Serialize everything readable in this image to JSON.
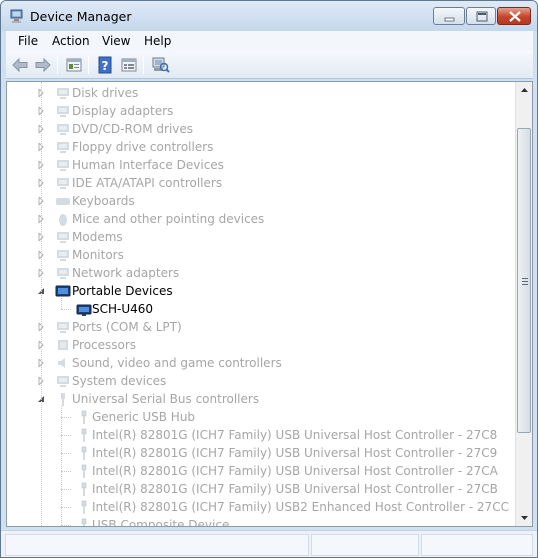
{
  "window": {
    "title": "Device Manager"
  },
  "menu": [
    {
      "label": "File"
    },
    {
      "label": "Action"
    },
    {
      "label": "View"
    },
    {
      "label": "Help"
    }
  ],
  "toolbar": [
    {
      "name": "back-button",
      "icon": "back-arrow-icon"
    },
    {
      "name": "forward-button",
      "icon": "forward-arrow-icon"
    },
    {
      "name": "show-hide-console-tree-button",
      "icon": "console-tree-icon"
    },
    {
      "name": "help-button",
      "icon": "help-icon"
    },
    {
      "name": "properties-button",
      "icon": "properties-icon"
    },
    {
      "name": "scan-hardware-changes-button",
      "icon": "scan-hardware-icon"
    }
  ],
  "tree": [
    {
      "label": "Disk drives",
      "state": "dim",
      "expander": "collapsed",
      "icon": "disk-drive-icon"
    },
    {
      "label": "Display adapters",
      "state": "dim",
      "expander": "collapsed",
      "icon": "display-adapter-icon"
    },
    {
      "label": "DVD/CD-ROM drives",
      "state": "dim",
      "expander": "collapsed",
      "icon": "dvd-drive-icon"
    },
    {
      "label": "Floppy drive controllers",
      "state": "dim",
      "expander": "collapsed",
      "icon": "floppy-controller-icon"
    },
    {
      "label": "Human Interface Devices",
      "state": "dim",
      "expander": "collapsed",
      "icon": "hid-icon"
    },
    {
      "label": "IDE ATA/ATAPI controllers",
      "state": "dim",
      "expander": "collapsed",
      "icon": "ide-controller-icon"
    },
    {
      "label": "Keyboards",
      "state": "dim",
      "expander": "collapsed",
      "icon": "keyboard-icon"
    },
    {
      "label": "Mice and other pointing devices",
      "state": "dim",
      "expander": "collapsed",
      "icon": "mouse-icon"
    },
    {
      "label": "Modems",
      "state": "dim",
      "expander": "collapsed",
      "icon": "modem-icon"
    },
    {
      "label": "Monitors",
      "state": "dim",
      "expander": "collapsed",
      "icon": "monitor-icon"
    },
    {
      "label": "Network adapters",
      "state": "dim",
      "expander": "collapsed",
      "icon": "network-adapter-icon"
    },
    {
      "label": "Portable Devices",
      "state": "active",
      "expander": "expanded",
      "icon": "portable-device-icon"
    },
    {
      "label": "SCH-U460",
      "state": "active",
      "expander": "none",
      "icon": "phone-device-icon",
      "child": true
    },
    {
      "label": "Ports (COM & LPT)",
      "state": "dim",
      "expander": "collapsed",
      "icon": "port-icon"
    },
    {
      "label": "Processors",
      "state": "dim",
      "expander": "collapsed",
      "icon": "processor-icon"
    },
    {
      "label": "Sound, video and game controllers",
      "state": "dim",
      "expander": "collapsed",
      "icon": "sound-icon"
    },
    {
      "label": "System devices",
      "state": "dim",
      "expander": "collapsed",
      "icon": "system-device-icon"
    },
    {
      "label": "Universal Serial Bus controllers",
      "state": "dim",
      "expander": "expanded",
      "icon": "usb-icon"
    },
    {
      "label": "Generic USB Hub",
      "state": "dim",
      "expander": "none",
      "icon": "usb-plug-icon",
      "child": true
    },
    {
      "label": "Intel(R) 82801G (ICH7 Family) USB Universal Host Controller - 27C8",
      "state": "dim",
      "expander": "none",
      "icon": "usb-plug-icon",
      "child": true
    },
    {
      "label": "Intel(R) 82801G (ICH7 Family) USB Universal Host Controller - 27C9",
      "state": "dim",
      "expander": "none",
      "icon": "usb-plug-icon",
      "child": true
    },
    {
      "label": "Intel(R) 82801G (ICH7 Family) USB Universal Host Controller - 27CA",
      "state": "dim",
      "expander": "none",
      "icon": "usb-plug-icon",
      "child": true
    },
    {
      "label": "Intel(R) 82801G (ICH7 Family) USB Universal Host Controller - 27CB",
      "state": "dim",
      "expander": "none",
      "icon": "usb-plug-icon",
      "child": true
    },
    {
      "label": "Intel(R) 82801G (ICH7 Family) USB2 Enhanced Host Controller - 27CC",
      "state": "dim",
      "expander": "none",
      "icon": "usb-plug-icon",
      "child": true
    },
    {
      "label": "USB Composite Device",
      "state": "dim",
      "expander": "none",
      "icon": "usb-plug-icon",
      "child": true
    }
  ],
  "colors": {
    "dim_text": "#a6a6a6",
    "titlebar": "#cfe0f1",
    "close_button": "#c5442b"
  }
}
